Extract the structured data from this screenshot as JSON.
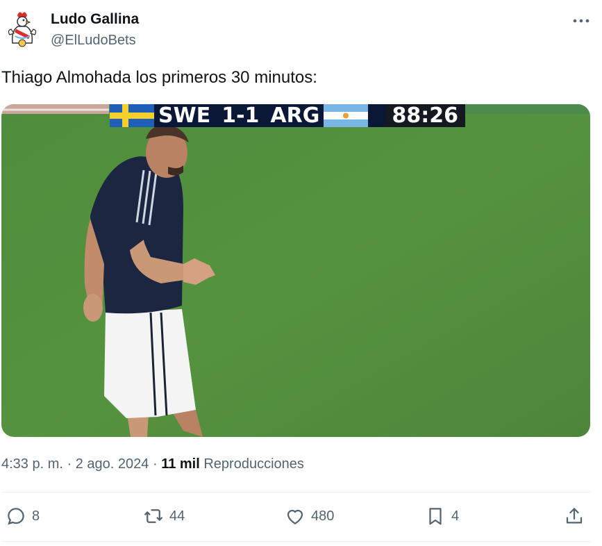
{
  "author": {
    "name": "Ludo Gallina",
    "handle": "@ElLudoBets",
    "avatar_icon": "rooster-mascot-icon"
  },
  "tweet": {
    "text": "Thiago Almohada los primeros 30 minutos:"
  },
  "media": {
    "scoreboard": {
      "home_team": "SWE",
      "score": "1-1",
      "away_team": "ARG",
      "clock": "88:26"
    }
  },
  "meta": {
    "time": "4:33 p. m.",
    "separator": "·",
    "date": "2 ago. 2024",
    "separator2": "·",
    "views_count": "11 mil",
    "views_label": "Reproducciones"
  },
  "actions": {
    "replies": "8",
    "reposts": "44",
    "likes": "480",
    "bookmarks": "4"
  },
  "colors": {
    "text": "#0f1419",
    "secondary": "#536471",
    "pitch": "#4f8a3f",
    "scoreboard_bg": "#0b1736"
  }
}
